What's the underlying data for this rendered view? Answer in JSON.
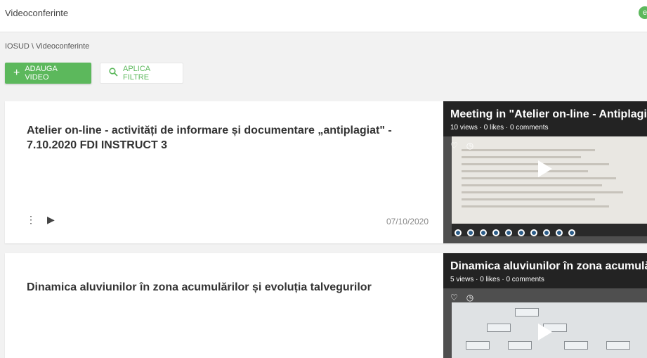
{
  "header": {
    "title": "Videoconferinte",
    "user_initial": "e"
  },
  "breadcrumb": "IOSUD \\ Videoconferinte",
  "toolbar": {
    "add_label": "ADAUGA VIDEO",
    "filter_label": "APLICA FILTRE"
  },
  "colors": {
    "accent": "#5cb85c",
    "background": "#f2f2f2"
  },
  "icons": {
    "add": "plus-icon",
    "filter": "search-icon",
    "menu": "kebab-menu-icon",
    "play": "play-icon",
    "like": "heart-icon",
    "watch_later": "clock-icon"
  },
  "videos": [
    {
      "title": "Atelier on-line - activități de informare și documentare „antiplagiat\" - 7.10.2020 FDI INSTRUCT 3",
      "date": "07/10/2020",
      "thumb_title": "Meeting in \"Atelier on-line - Antiplagiat\"",
      "thumb_stats": "10 views · 0 likes · 0 comments"
    },
    {
      "title": "Dinamica aluviunilor în zona acumulărilor și evoluția talvegurilor",
      "date": "",
      "thumb_title": "Dinamica aluviunilor în zona acumulărilor",
      "thumb_stats": "5 views · 0 likes · 0 comments"
    }
  ]
}
